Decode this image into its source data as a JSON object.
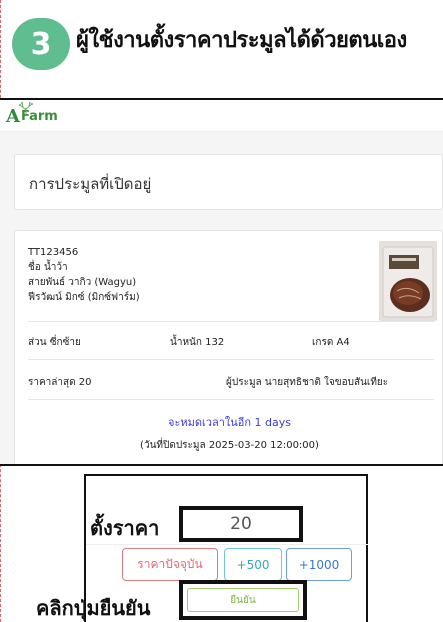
{
  "step": {
    "number": "3",
    "title": "ผู้ใช้งานตั้งราคาประมูลได้ด้วยตนเอง"
  },
  "app": {
    "logo_a": "A",
    "logo_farm": "Farm"
  },
  "auctions": {
    "section_title": "การประมูลที่เปิดอยู่"
  },
  "item": {
    "code": "TT123456",
    "name": "ชื่อ น้ำว้า",
    "breed": "สายพันธ์ วากิว (Wagyu)",
    "farm": "ฟีรวัฒน์ มิกซ์ (มิกซ์ฟาร์ม)",
    "part": "ส่วน ซี่กซ้าย",
    "weight": "น้ำหนัก 132",
    "grade": "เกรด A4",
    "latest_price": "ราคาล่าสุด 20",
    "bidder": "ผู้ประมูล นายสุทธิชาติ ใจขอบสันเทียะ",
    "countdown": "จะหมดเวลาในอีก 1 days",
    "closing": "(วันที่ปิดประมูล 2025-03-20 12:00:00)"
  },
  "bid": {
    "set_price_label": "ตั้งราคา",
    "price_value": "20",
    "current_price_button": "ราคาปัจจุบัน",
    "plus_500_button": "+500",
    "plus_1000_button": "+1000",
    "confirm_label": "คลิกปุ่มยืนยัน",
    "confirm_button": "ยืนยัน"
  },
  "colors": {
    "badge": "#5fbd8f",
    "countdown": "#3b3bd8",
    "confirm": "#7bb53c"
  }
}
